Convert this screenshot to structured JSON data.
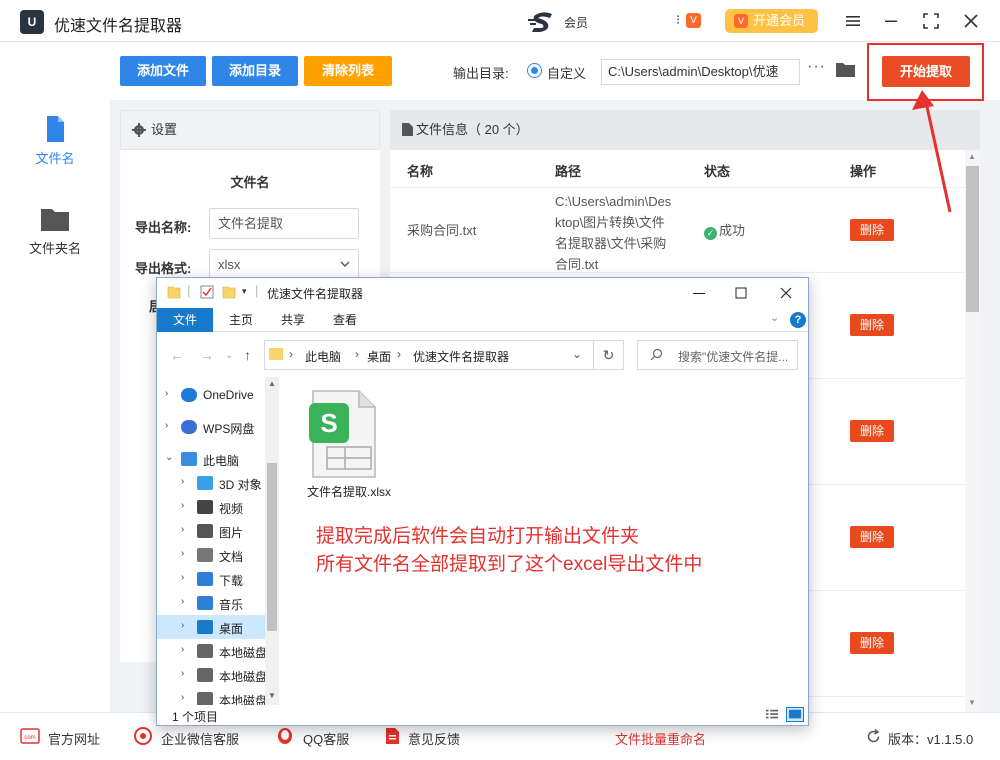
{
  "app": {
    "title": "优速文件名提取器",
    "logo_text": "U",
    "brand_text": "会员",
    "vip_label": "开通会员",
    "vip_badge": "V"
  },
  "sidebar": {
    "items": [
      {
        "label": "文件名",
        "active": true
      },
      {
        "label": "文件夹名",
        "active": false
      }
    ]
  },
  "toolbar": {
    "add_file": "添加文件",
    "add_dir": "添加目录",
    "clear_list": "清除列表",
    "output_label": "输出目录:",
    "radio_label": "自定义",
    "output_path": "C:\\Users\\admin\\Desktop\\优速",
    "more": "···",
    "start": "开始提取"
  },
  "settings": {
    "header": "设置",
    "section_title": "文件名",
    "export_name_label": "导出名称:",
    "export_name_value": "文件名提取",
    "export_format_label": "导出格式:",
    "export_format_value": "xlsx",
    "partial_label": "居"
  },
  "filelist": {
    "header": "文件信息（ 20 个）",
    "columns": {
      "name": "名称",
      "path": "路径",
      "status": "状态",
      "action": "操作"
    },
    "rows": [
      {
        "name": "采购合同.txt",
        "path": "C:\\Users\\admin\\Desktop\\图片转换\\文件名提取器\\文件\\采购合同.txt",
        "status": "成功",
        "action": "删除"
      },
      {
        "action": "删除"
      },
      {
        "action": "删除"
      },
      {
        "action": "删除"
      },
      {
        "action": "删除"
      }
    ]
  },
  "footer": {
    "website": "官方网址",
    "wechat": "企业微信客服",
    "qq": "QQ客服",
    "feedback": "意见反馈",
    "center_link": "文件批量重命名",
    "version": "版本：v1.1.5.0",
    "com_icon_text": "com"
  },
  "explorer": {
    "title": "优速文件名提取器",
    "tabs": [
      "文件",
      "主页",
      "共享",
      "查看"
    ],
    "help": "?",
    "breadcrumb": [
      "此电脑",
      "桌面",
      "优速文件名提取器"
    ],
    "search_placeholder": "搜索\"优速文件名提...",
    "nav": [
      {
        "label": "OneDrive",
        "icon": "cloud-icon",
        "level": 0,
        "chev": "›"
      },
      {
        "label": "WPS网盘",
        "icon": "wps-cloud-icon",
        "level": 0,
        "chev": "›"
      },
      {
        "label": "此电脑",
        "icon": "computer-icon",
        "level": 0,
        "chev": "⌄"
      },
      {
        "label": "3D 对象",
        "icon": "cube-icon",
        "level": 1,
        "chev": "›"
      },
      {
        "label": "视频",
        "icon": "film-icon",
        "level": 1,
        "chev": "›"
      },
      {
        "label": "图片",
        "icon": "picture-icon",
        "level": 1,
        "chev": "›"
      },
      {
        "label": "文档",
        "icon": "document-icon",
        "level": 1,
        "chev": "›"
      },
      {
        "label": "下载",
        "icon": "download-icon",
        "level": 1,
        "chev": "›"
      },
      {
        "label": "音乐",
        "icon": "music-icon",
        "level": 1,
        "chev": "›"
      },
      {
        "label": "桌面",
        "icon": "desktop-icon",
        "level": 1,
        "chev": "›",
        "selected": true
      },
      {
        "label": "本地磁盘 (",
        "icon": "drive-icon",
        "level": 1,
        "chev": "›"
      },
      {
        "label": "本地磁盘 (",
        "icon": "drive-icon",
        "level": 1,
        "chev": "›"
      },
      {
        "label": "本地磁盘 (",
        "icon": "drive-icon",
        "level": 1,
        "chev": "›"
      }
    ],
    "file": {
      "name": "文件名提取.xlsx",
      "badge": "S"
    },
    "annotation": [
      "提取完成后软件会自动打开输出文件夹",
      "所有文件名全部提取到了这个excel导出文件中"
    ],
    "status_count": "1 个项目"
  },
  "colors": {
    "primary": "#2f86e8",
    "orange": "#ffa200",
    "start": "#ea4d25",
    "danger": "#e8491d",
    "highlight": "#e5322e",
    "wps_green": "#3cb35a"
  }
}
